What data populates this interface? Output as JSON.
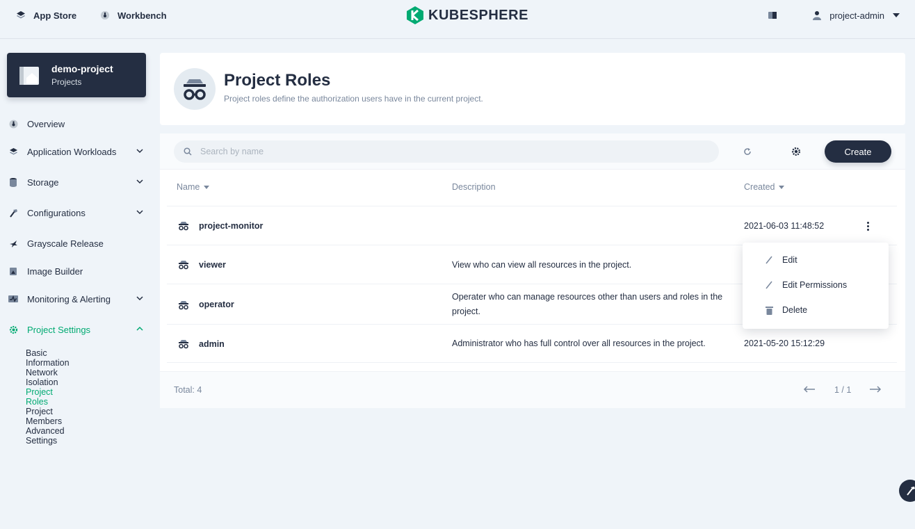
{
  "topbar": {
    "app_store": "App Store",
    "workbench": "Workbench",
    "logo_text": "KUBESPHERE",
    "user": "project-admin"
  },
  "project": {
    "name": "demo-project",
    "type": "Projects"
  },
  "sidebar": {
    "items": [
      {
        "label": "Overview"
      },
      {
        "label": "Application Workloads"
      },
      {
        "label": "Storage"
      },
      {
        "label": "Configurations"
      },
      {
        "label": "Grayscale Release"
      },
      {
        "label": "Image Builder"
      },
      {
        "label": "Monitoring & Alerting"
      },
      {
        "label": "Project Settings"
      }
    ],
    "sub_items": [
      {
        "label": "Basic Information"
      },
      {
        "label": "Network Isolation"
      },
      {
        "label": "Project Roles"
      },
      {
        "label": "Project Members"
      },
      {
        "label": "Advanced Settings"
      }
    ]
  },
  "header": {
    "title": "Project Roles",
    "description": "Project roles define the authorization users have in the current project."
  },
  "toolbar": {
    "search_placeholder": "Search by name",
    "create_label": "Create"
  },
  "table": {
    "columns": {
      "name": "Name",
      "description": "Description",
      "created": "Created"
    },
    "rows": [
      {
        "name": "project-monitor",
        "description": "",
        "created": "2021-06-03 11:48:52"
      },
      {
        "name": "viewer",
        "description": "View who can view all resources in the project.",
        "created": ""
      },
      {
        "name": "operator",
        "description_line1": "Operater who can manage resources other than users and roles in the",
        "description_line2": "project.",
        "created": ""
      },
      {
        "name": "admin",
        "description": "Administrator who has full control over all resources in the project.",
        "created": "2021-05-20 15:12:29"
      }
    ],
    "total": "Total: 4",
    "pagination": "1 / 1"
  },
  "menu": {
    "edit": "Edit",
    "edit_permissions": "Edit Permissions",
    "delete": "Delete"
  },
  "colors": {
    "accent": "#00aa72",
    "dark": "#242e42",
    "muted": "#79879c"
  }
}
